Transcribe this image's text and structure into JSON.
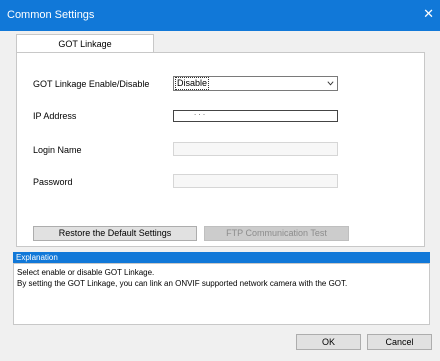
{
  "window": {
    "title": "Common Settings",
    "close_glyph": "✕"
  },
  "tabs": [
    {
      "label": "GOT Linkage"
    }
  ],
  "form": {
    "enable_label": "GOT Linkage Enable/Disable",
    "enable_value": "Disable",
    "ip_label": "IP Address",
    "ip_dots": ".   .   .",
    "login_label": "Login Name",
    "password_label": "Password"
  },
  "buttons": {
    "restore": "Restore the Default Settings",
    "ftp_test": "FTP Communication Test",
    "ok": "OK",
    "cancel": "Cancel"
  },
  "explanation": {
    "title": "Explanation",
    "line1": "Select enable or disable GOT Linkage.",
    "line2": "By setting the GOT Linkage, you can link an ONVIF supported network camera with the GOT."
  },
  "colors": {
    "titlebar": "#1178d8",
    "explanation_header": "#1178d8"
  }
}
